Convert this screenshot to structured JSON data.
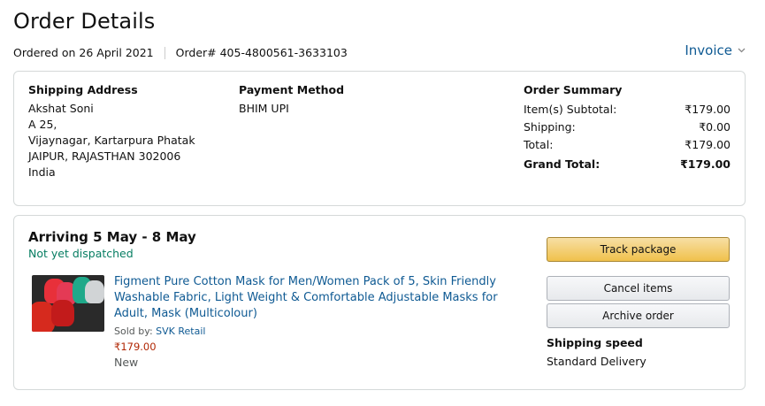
{
  "header": {
    "title": "Order Details",
    "ordered_on": "Ordered on 26 April 2021",
    "order_number": "Order# 405-4800561-3633103",
    "invoice_label": "Invoice"
  },
  "summary": {
    "shipping": {
      "title": "Shipping Address",
      "lines": [
        "Akshat Soni",
        "A 25,",
        "Vijaynagar, Kartarpura Phatak",
        "JAIPUR, RAJASTHAN 302006",
        "India"
      ]
    },
    "payment": {
      "title": "Payment Method",
      "method": "BHIM UPI"
    },
    "order_summary": {
      "title": "Order Summary",
      "rows": [
        {
          "label": "Item(s) Subtotal:",
          "value": "₹179.00"
        },
        {
          "label": "Shipping:",
          "value": "₹0.00"
        },
        {
          "label": "Total:",
          "value": "₹179.00"
        },
        {
          "label": "Grand Total:",
          "value": "₹179.00"
        }
      ]
    }
  },
  "shipment": {
    "arriving": "Arriving 5 May - 8 May",
    "status": "Not yet dispatched",
    "product": {
      "title": "Figment Pure Cotton Mask for Men/Women Pack of 5, Skin Friendly Washable Fabric, Light Weight & Comfortable Adjustable Masks for Adult, Mask (Multicolour)",
      "sold_by_prefix": "Sold by: ",
      "seller": "SVK Retail",
      "price": "₹179.00",
      "condition": "New"
    },
    "buttons": {
      "track": "Track package",
      "cancel": "Cancel items",
      "archive": "Archive order"
    },
    "shipping_speed_label": "Shipping speed",
    "shipping_speed_value": "Standard Delivery"
  },
  "colors": {
    "link": "#0f5a93",
    "status_green": "#067d62",
    "price_red": "#b12704",
    "track_button": "#f0c14b"
  }
}
